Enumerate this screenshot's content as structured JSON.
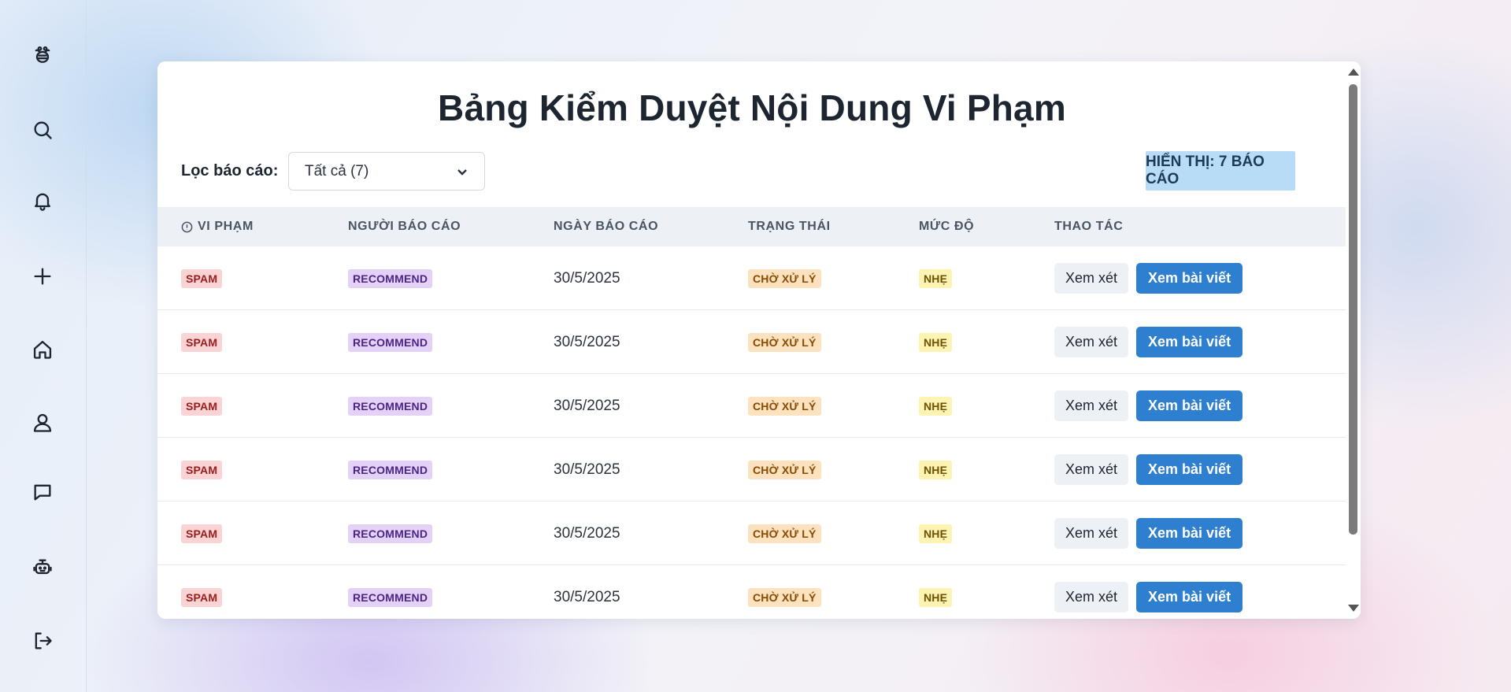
{
  "sidebar": {
    "items": [
      {
        "icon": "bee-logo-icon"
      },
      {
        "icon": "search-icon"
      },
      {
        "icon": "bell-icon"
      },
      {
        "icon": "plus-icon"
      },
      {
        "icon": "home-icon"
      },
      {
        "icon": "user-icon"
      },
      {
        "icon": "chat-icon"
      },
      {
        "icon": "robot-icon"
      },
      {
        "icon": "logout-icon"
      }
    ]
  },
  "page": {
    "title": "Bảng Kiểm Duyệt Nội Dung Vi Phạm",
    "filter_label": "Lọc báo cáo:",
    "filter_value": "Tất cả (7)",
    "count_badge": "HIỂN THỊ: 7 BÁO CÁO"
  },
  "table": {
    "headers": {
      "violation": "VI PHẠM",
      "reporter": "NGƯỜI BÁO CÁO",
      "date": "NGÀY BÁO CÁO",
      "status": "TRẠNG THÁI",
      "level": "MỨC ĐỘ",
      "actions": "THAO TÁC"
    },
    "rows": [
      {
        "violation": "SPAM",
        "reporter": "RECOMMEND",
        "date": "30/5/2025",
        "status": "CHỜ XỬ LÝ",
        "level": "NHẸ",
        "review": "Xem xét",
        "view": "Xem bài viết"
      },
      {
        "violation": "SPAM",
        "reporter": "RECOMMEND",
        "date": "30/5/2025",
        "status": "CHỜ XỬ LÝ",
        "level": "NHẸ",
        "review": "Xem xét",
        "view": "Xem bài viết"
      },
      {
        "violation": "SPAM",
        "reporter": "RECOMMEND",
        "date": "30/5/2025",
        "status": "CHỜ XỬ LÝ",
        "level": "NHẸ",
        "review": "Xem xét",
        "view": "Xem bài viết"
      },
      {
        "violation": "SPAM",
        "reporter": "RECOMMEND",
        "date": "30/5/2025",
        "status": "CHỜ XỬ LÝ",
        "level": "NHẸ",
        "review": "Xem xét",
        "view": "Xem bài viết"
      },
      {
        "violation": "SPAM",
        "reporter": "RECOMMEND",
        "date": "30/5/2025",
        "status": "CHỜ XỬ LÝ",
        "level": "NHẸ",
        "review": "Xem xét",
        "view": "Xem bài viết"
      },
      {
        "violation": "SPAM",
        "reporter": "RECOMMEND",
        "date": "30/5/2025",
        "status": "CHỜ XỬ LÝ",
        "level": "NHẸ",
        "review": "Xem xét",
        "view": "Xem bài viết"
      }
    ]
  },
  "colors": {
    "primary_button": "#2f7fd1",
    "count_badge_bg": "#b8dcf5",
    "spam_badge_bg": "#fad4d4",
    "reporter_badge_bg": "#e3d2f6",
    "status_badge_bg": "#fde2c0",
    "level_badge_bg": "#fdf3b3"
  }
}
